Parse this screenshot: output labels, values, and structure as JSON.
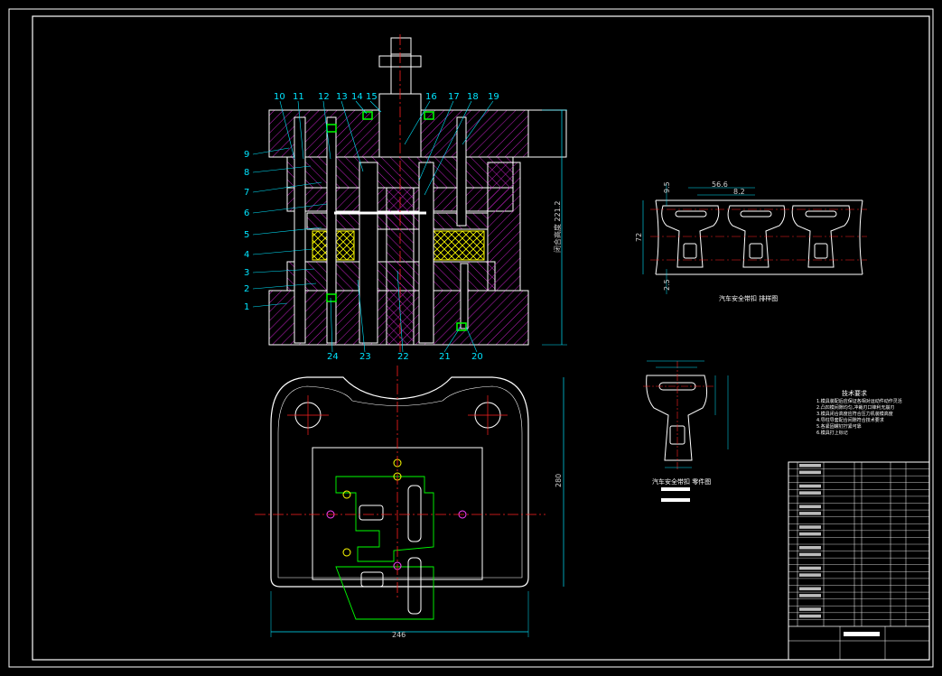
{
  "part_numbers": {
    "left": [
      "1",
      "2",
      "3",
      "4",
      "5",
      "6",
      "7",
      "8",
      "9"
    ],
    "top": [
      "10",
      "11",
      "12",
      "13",
      "14",
      "15",
      "16",
      "17",
      "18",
      "19"
    ],
    "bottom": [
      "24",
      "23",
      "22",
      "21",
      "20"
    ]
  },
  "dimensions": {
    "assembly_height": "闭合高度 221.2",
    "plan_width": "246",
    "plan_height": "280",
    "strip_pitch": "56.6",
    "strip_height": "72",
    "strip_sub": "8.2",
    "strip_top": "9.5",
    "strip_bottom": "2.5"
  },
  "captions": {
    "strip_layout": "汽车安全带扣   排样图",
    "part_drawing": "汽车安全带扣   零件图"
  },
  "notes": {
    "heading": "技术要求",
    "lines": [
      "1.模具装配后应保证各相对运动件动作灵活",
      "2.凸凹模间隙均匀,冲裁刃口锋利无崩刃",
      "3.模具闭合高度应符合压力机装模高度",
      "4.导柱导套配合间隙符合技术要求",
      "5.各紧固螺钉拧紧可靠",
      "6.模具打上标记"
    ]
  },
  "colors": {
    "background": "#000000",
    "outline": "#ffffff",
    "hatch": "#c020c0",
    "cyan": "#00e5ff",
    "green": "#00ff00",
    "yellow": "#ffff00",
    "center": "#ff2020"
  }
}
